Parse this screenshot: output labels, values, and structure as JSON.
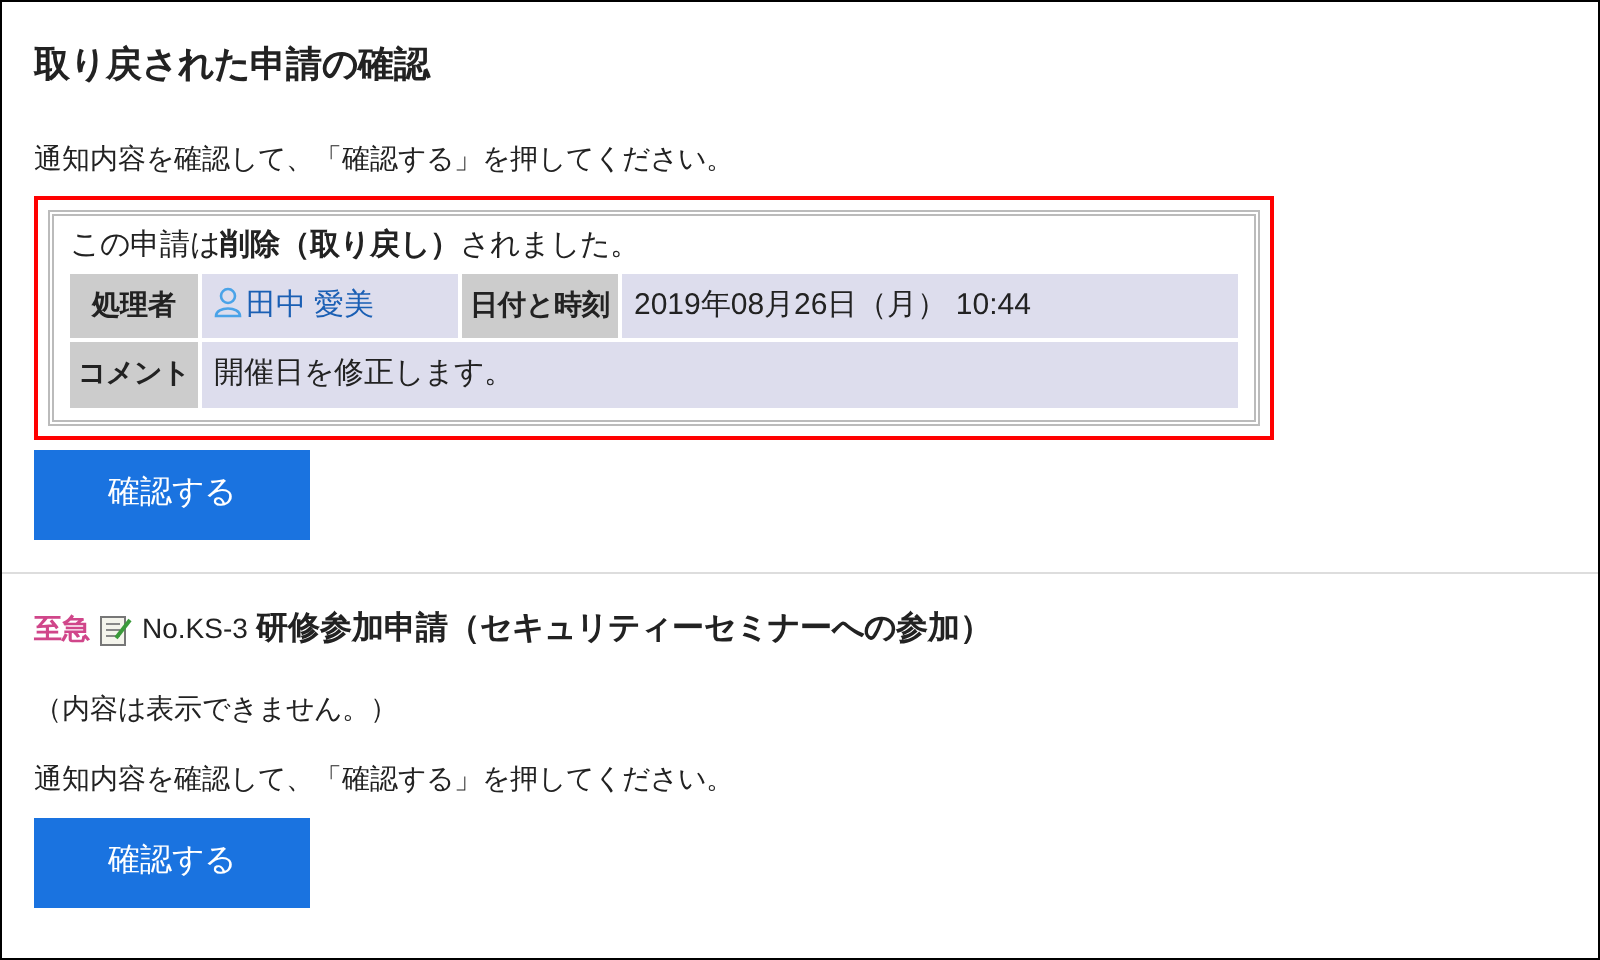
{
  "title": "取り戻された申請の確認",
  "first": {
    "instruction": "通知内容を確認して、「確認する」を押してください。",
    "notice": {
      "message": "この申請は**削除（取り戻し）**されました。",
      "rows": [
        {
          "cells": [
            {
              "kind": "label",
              "text": "処理者"
            },
            {
              "kind": "user",
              "text": "田中 愛美"
            },
            {
              "kind": "label",
              "text": "日付と時刻"
            },
            {
              "kind": "value",
              "text": "2019年08月26日（月） 10:44"
            }
          ]
        },
        {
          "cells": [
            {
              "kind": "label",
              "text": "コメント"
            },
            {
              "kind": "value",
              "text": "開催日を修正します。"
            }
          ]
        }
      ]
    },
    "button": "確認する"
  },
  "second": {
    "priority": "至急",
    "number": "No.KS-3",
    "subject": "研修参加申請（セキュリティーセミナーへの参加）",
    "hidden_note": "（内容は表示できません。）",
    "instruction": "通知内容を確認して、「確認する」を押してください。",
    "button": "確認する"
  }
}
